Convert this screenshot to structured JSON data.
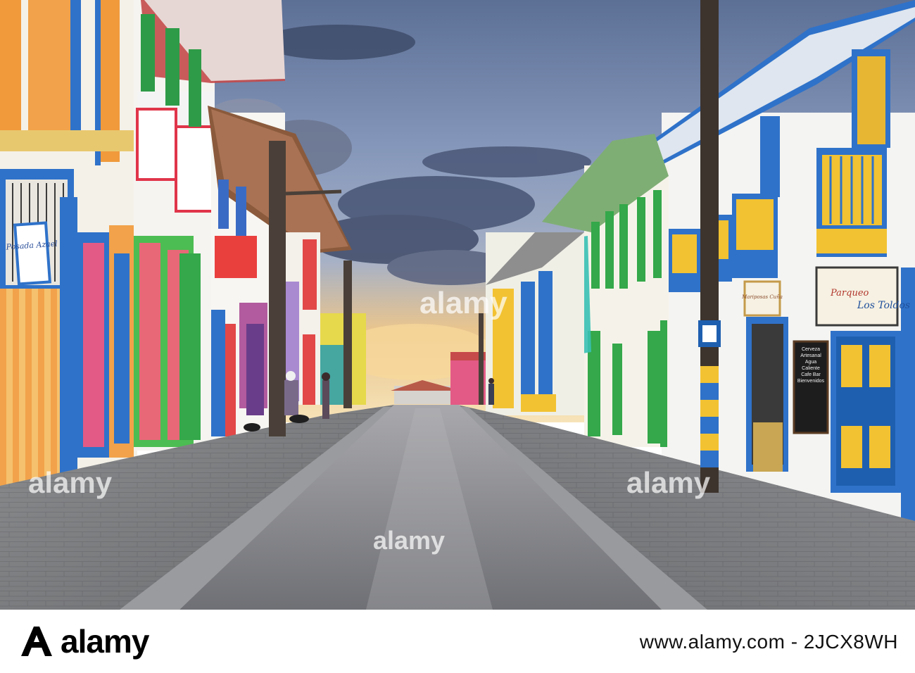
{
  "scene": {
    "description_colors": {
      "sky_top": "#5a6f93",
      "sky_mid": "#8fa4c2",
      "sky_glow": "#f0c887",
      "street": "#8a8b90",
      "sidewalk": "#7d7f82"
    }
  },
  "signs": {
    "left_shop": "Posada Azael",
    "right_shop_word1": "Parqueo",
    "right_shop_word2": "Los Toldos",
    "right_small": "Mariposas Cuña",
    "chalkboard": "Cerveza Artesanal Agua Caliente Cafe Bar Bienvenidos"
  },
  "watermarks": {
    "center": "alamy",
    "left": "alamy",
    "right": "alamy",
    "bottom": "alamy"
  },
  "footer": {
    "brand": "alamy",
    "image_id": "www.alamy.com - 2JCX8WH"
  }
}
